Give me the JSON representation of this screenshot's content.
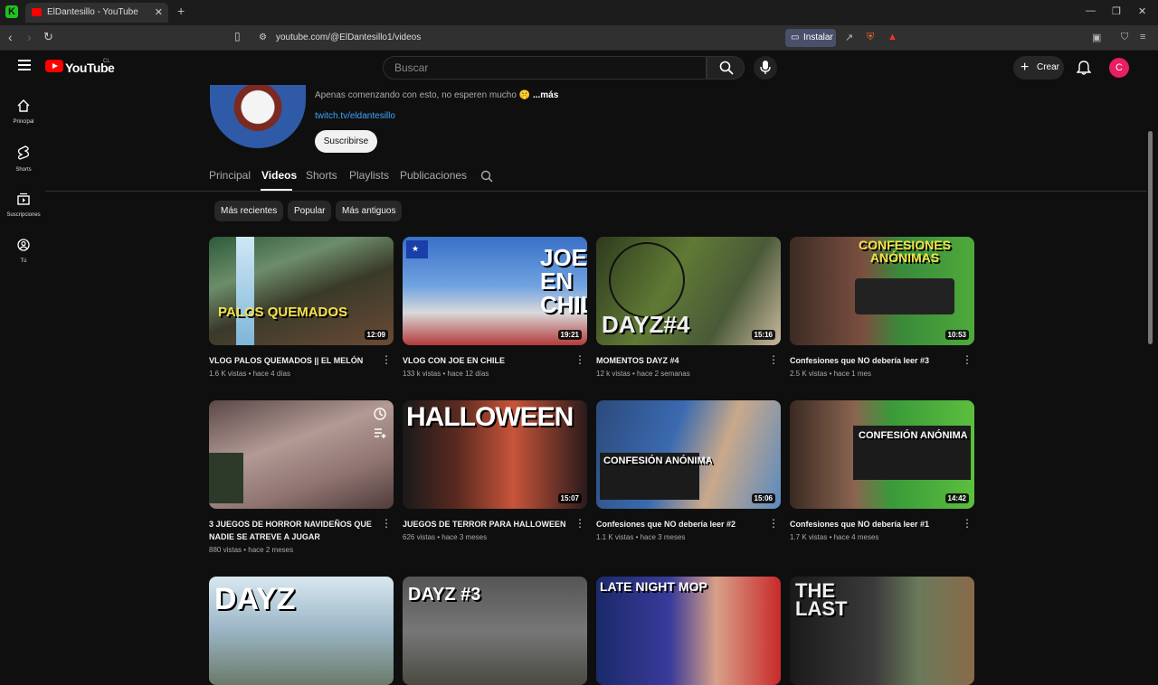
{
  "browser": {
    "tab_title": "ElDantesillo - YouTube",
    "url": "youtube.com/@ElDantesillo1/videos",
    "install_label": "Instalar"
  },
  "header": {
    "logo_text": "YouTube",
    "country_code": "CL",
    "search_placeholder": "Buscar",
    "create_label": "Crear",
    "avatar_letter": "C"
  },
  "sidebar": {
    "items": [
      {
        "label": "Principal",
        "icon": "home-icon"
      },
      {
        "label": "Shorts",
        "icon": "shorts-icon"
      },
      {
        "label": "Suscripciones",
        "icon": "subscriptions-icon"
      },
      {
        "label": "Tú",
        "icon": "you-icon"
      }
    ]
  },
  "channel": {
    "description": "Apenas comenzando con esto, no esperen mucho 🤫",
    "more_label": "...más",
    "link": "twitch.tv/eldantesillo",
    "subscribe_label": "Suscribirse",
    "tabs": [
      "Principal",
      "Videos",
      "Shorts",
      "Playlists",
      "Publicaciones"
    ],
    "active_tab": "Videos"
  },
  "filters": [
    "Más recientes",
    "Popular",
    "Más antiguos"
  ],
  "videos": [
    {
      "title": "VLOG PALOS QUEMADOS || EL MELÓN",
      "views": "1.6 K vistas",
      "age": "hace 4 días",
      "duration": "12:09",
      "thumb_text": "PALOS QUEMADOS"
    },
    {
      "title": "VLOG CON JOE EN CHILE",
      "views": "133 k vistas",
      "age": "hace 12 días",
      "duration": "19:21",
      "thumb_text": "JOE EN CHILE"
    },
    {
      "title": "MOMENTOS DAYZ #4",
      "views": "12 k vistas",
      "age": "hace 2 semanas",
      "duration": "15:16",
      "thumb_text": "DAYZ#4"
    },
    {
      "title": "Confesiones que NO debería leer #3",
      "views": "2.5 K vistas",
      "age": "hace 1 mes",
      "duration": "10:53",
      "thumb_text": "CONFESIONES ANÓNIMAS"
    },
    {
      "title": "3 JUEGOS DE HORROR NAVIDEÑOS QUE NADIE SE ATREVE A JUGAR",
      "views": "880 vistas",
      "age": "hace 2 meses",
      "duration": "",
      "thumb_text": ""
    },
    {
      "title": "JUEGOS DE TERROR PARA HALLOWEEN",
      "views": "626 vistas",
      "age": "hace 3 meses",
      "duration": "15:07",
      "thumb_text": "HALLOWEEN"
    },
    {
      "title": "Confesiones que NO debería leer #2",
      "views": "1.1 K vistas",
      "age": "hace 3 meses",
      "duration": "15:06",
      "thumb_text": "CONFESIÓN ANÓNIMA"
    },
    {
      "title": "Confesiones que NO debería leer #1",
      "views": "1.7 K vistas",
      "age": "hace 4 meses",
      "duration": "14:42",
      "thumb_text": "CONFESIÓN ANÓNIMA"
    },
    {
      "title": "",
      "views": "",
      "age": "",
      "duration": "",
      "thumb_text": "DAYZ"
    },
    {
      "title": "",
      "views": "",
      "age": "",
      "duration": "",
      "thumb_text": "DAYZ #3"
    },
    {
      "title": "",
      "views": "",
      "age": "",
      "duration": "",
      "thumb_text": "LATE NIGHT MOP"
    },
    {
      "title": "",
      "views": "",
      "age": "",
      "duration": "",
      "thumb_text": "THE LAST"
    }
  ],
  "colors": {
    "background": "#0f0f0f",
    "accent": "#ff0000",
    "link": "#3ea6ff"
  }
}
